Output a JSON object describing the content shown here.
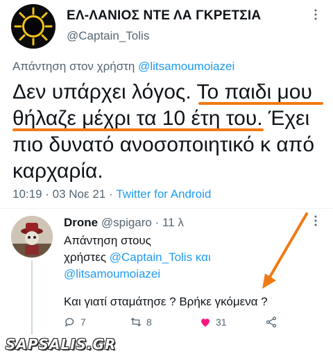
{
  "tweet": {
    "display_name": "ΕΛ-ΛΑΝΙΟΣ ΝΤΕ ΛΑ ΓΚΡΕΤΣΙΑ",
    "handle": "@Captain_Tolis",
    "more_glyph": "⋮",
    "reply_prefix": "Απάντηση στον χρήστη",
    "reply_mention": "@litsamoumoiazei",
    "body_lines": [
      "Δεν υπάρχει λόγος. Το παιδι μου",
      "θήλαζε μέχρι τα 10 έτη του. Έχει",
      "πιο δυνατό ανοσοποιητικό κ από",
      "καρχαρία."
    ],
    "time": "10:19 · 03 Νοε 21 ·",
    "source": "Twitter for Android"
  },
  "reply": {
    "name": "Drone",
    "handle": "@spigaro",
    "age": "· 11 λ",
    "more_glyph": "⋮",
    "reply_line1": "Απάντηση στους",
    "reply_line2_prefix": "χρήστες",
    "reply_mention1": "@Captain_Tolis",
    "reply_and": "και",
    "reply_mention2": "@litsamoumoiazei",
    "body": "Και γιατί σταμάτησε ? Βρήκε γκόμενα ?",
    "stats": {
      "replies": "7",
      "retweets": "8",
      "likes": "31"
    }
  },
  "footer": {
    "brand": "SAPSALIS.GR"
  },
  "colors": {
    "accent": "#1d9bf0",
    "highlight": "#f07a14",
    "like": "#f91880"
  }
}
